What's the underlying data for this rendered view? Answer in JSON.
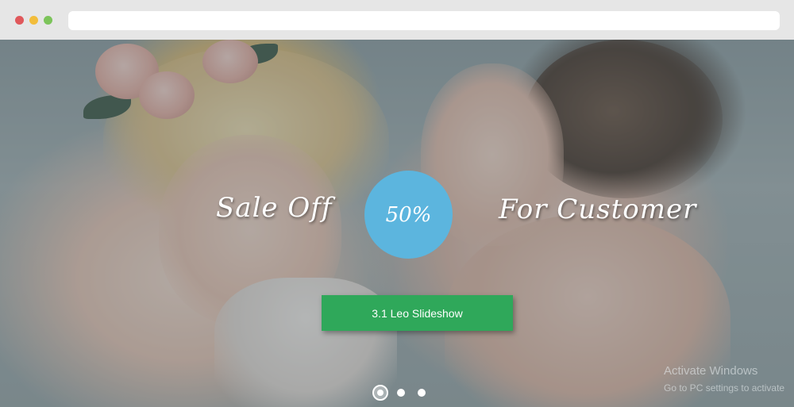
{
  "slideshow": {
    "caption_left": "Sale Off",
    "discount": "50%",
    "caption_right": "For Customer",
    "button_label": "3.1  Leo Slideshow",
    "pager": {
      "count": 3,
      "active_index": 0
    }
  },
  "watermark": {
    "title": "Activate Windows",
    "subtitle": "Go to PC settings to activate"
  },
  "colors": {
    "circle": "#5cb5de",
    "button": "#2fa85a",
    "titlebar": "#e6e6e6"
  }
}
